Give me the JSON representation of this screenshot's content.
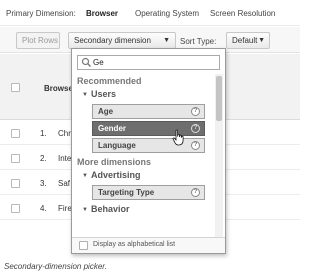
{
  "topbar": {
    "primary_dimension_label": "Primary Dimension:",
    "tabs": [
      "Browser",
      "Operating System",
      "Screen Resolution"
    ],
    "active_tab": "Browser"
  },
  "controls": {
    "plot_rows_label": "Plot Rows",
    "secondary_dimension_label": "Secondary dimension",
    "sort_type_label": "Sort Type:",
    "sort_type_value": "Default"
  },
  "table": {
    "header_label": "Browser",
    "rows": [
      {
        "index": "1.",
        "name": "Chr"
      },
      {
        "index": "2.",
        "name": "Inte"
      },
      {
        "index": "3.",
        "name": "Saf"
      },
      {
        "index": "4.",
        "name": "Fire"
      }
    ]
  },
  "dropdown": {
    "search_value": "Ge",
    "sections": {
      "recommended": "Recommended",
      "more": "More dimensions"
    },
    "groups": {
      "users": "Users",
      "advertising": "Advertising",
      "behavior": "Behavior"
    },
    "items": {
      "age": "Age",
      "gender": "Gender",
      "language": "Language",
      "targeting_type": "Targeting Type"
    },
    "help_glyph": "?",
    "selected_item": "Gender",
    "footer_label": "Display as alphabetical list"
  },
  "caption": "Secondary-dimension picker.",
  "colors": {
    "selected_item_bg": "#6e6e6e",
    "item_bg": "#e6e6e6",
    "header_bg": "#f2f2f2"
  },
  "icons": [
    "search-icon",
    "caret-down-icon",
    "help-icon",
    "hand-pointer-cursor-icon"
  ]
}
